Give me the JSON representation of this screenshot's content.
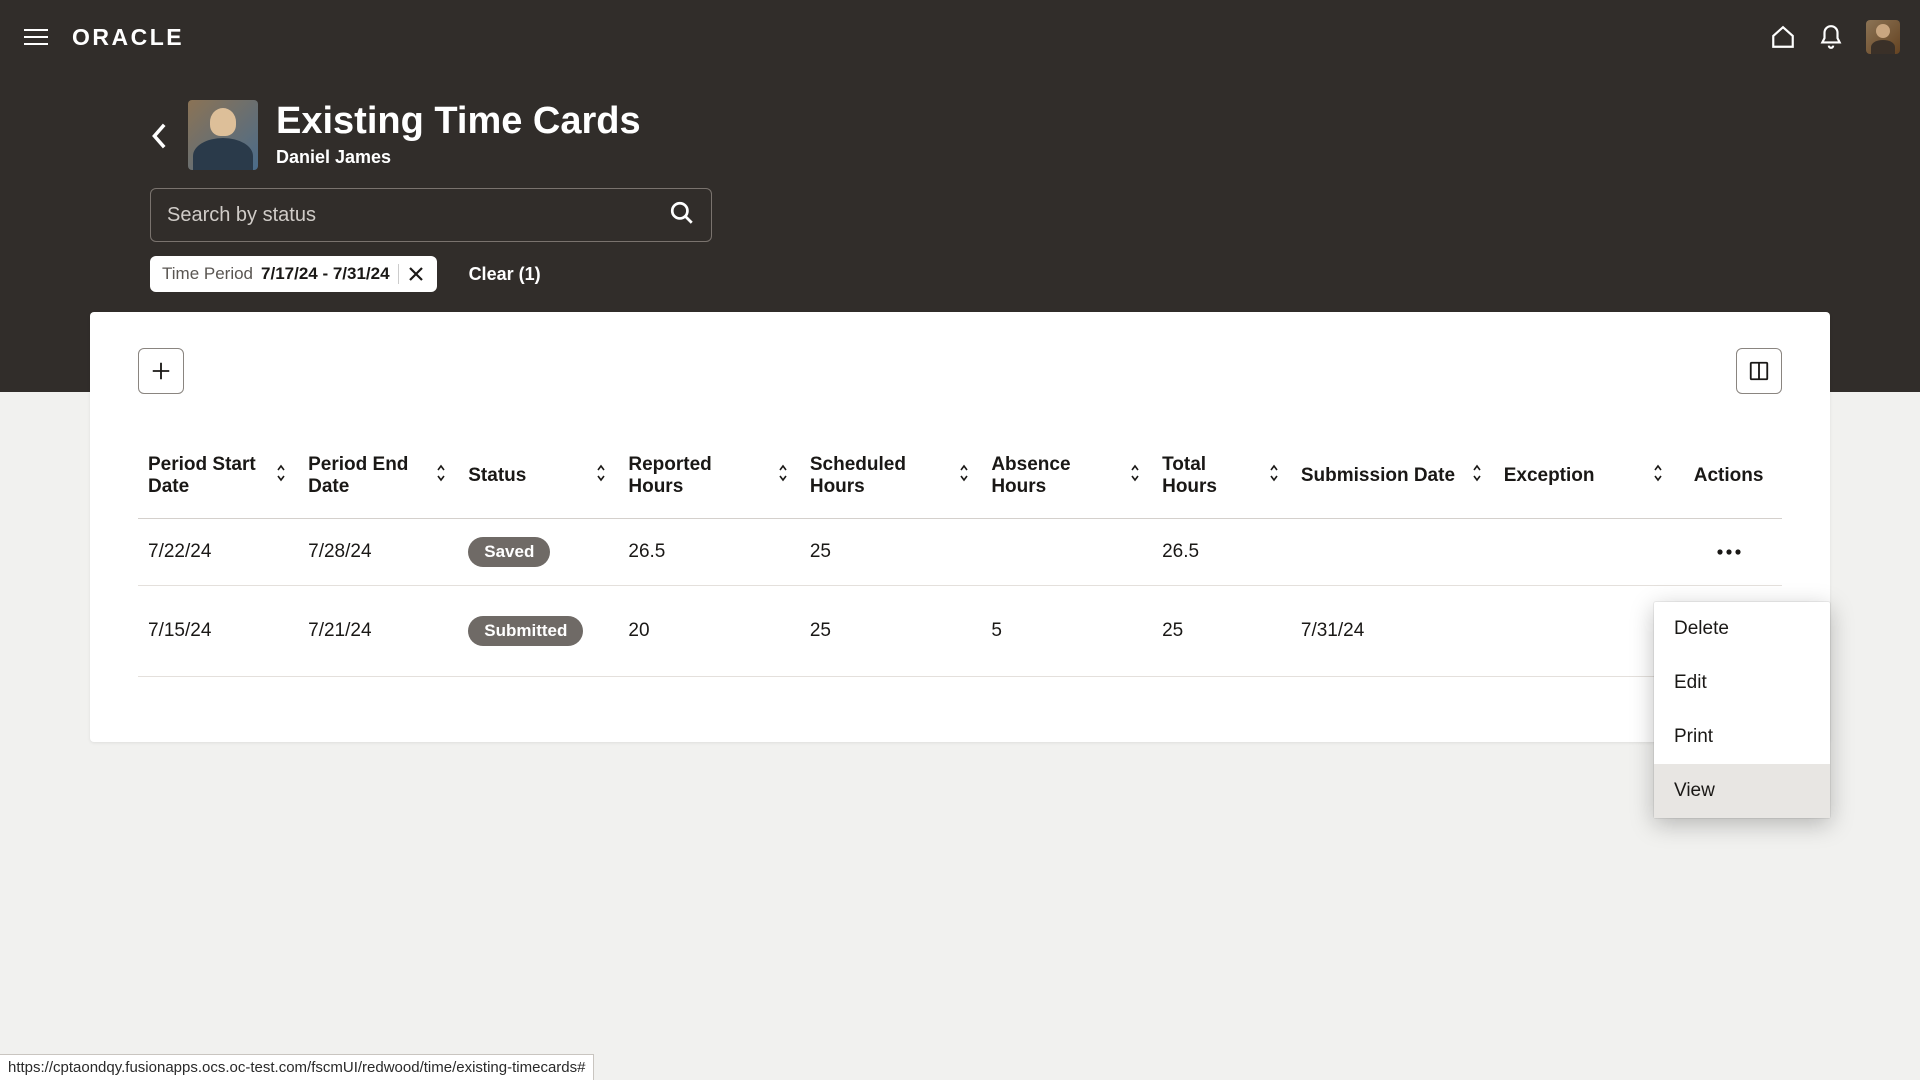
{
  "brand": "ORACLE",
  "page": {
    "title": "Existing Time Cards",
    "subtitle": "Daniel James"
  },
  "search": {
    "placeholder": "Search by status"
  },
  "filter": {
    "label": "Time Period",
    "value": "7/17/24 - 7/31/24",
    "clear": "Clear (1)"
  },
  "columns": {
    "period_start": "Period Start Date",
    "period_end": "Period End Date",
    "status": "Status",
    "reported": "Reported Hours",
    "scheduled": "Scheduled Hours",
    "absence": "Absence Hours",
    "total": "Total Hours",
    "submission": "Submission Date",
    "exception": "Exception",
    "actions": "Actions"
  },
  "rows": [
    {
      "start": "7/22/24",
      "end": "7/28/24",
      "status": "Saved",
      "reported": "26.5",
      "scheduled": "25",
      "absence": "",
      "total": "26.5",
      "submission": "",
      "exception": ""
    },
    {
      "start": "7/15/24",
      "end": "7/21/24",
      "status": "Submitted",
      "reported": "20",
      "scheduled": "25",
      "absence": "5",
      "total": "25",
      "submission": "7/31/24",
      "exception": ""
    }
  ],
  "menu": {
    "delete": "Delete",
    "edit": "Edit",
    "print": "Print",
    "view": "View"
  },
  "status_url": "https://cptaondqy.fusionapps.ocs.oc-test.com/fscmUI/redwood/time/existing-timecards#"
}
